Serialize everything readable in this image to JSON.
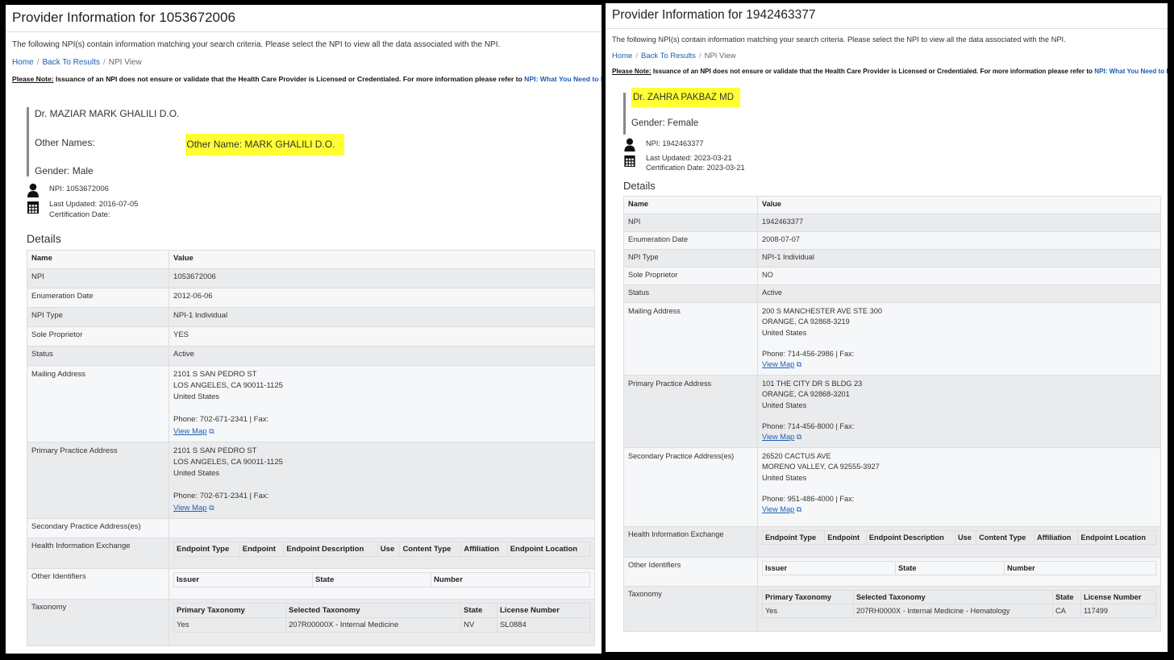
{
  "left": {
    "title": "Provider Information for 1053672006",
    "intro": "The following NPI(s) contain information matching your search criteria. Please select the NPI to view all the data associated with the NPI.",
    "breadcrumb": {
      "home": "Home",
      "back": "Back To Results",
      "current": "NPI View"
    },
    "note": {
      "label": "Please Note:",
      "text": " Issuance of an NPI does not ensure or validate that the Health Care Provider is Licensed or Credentialed. For more information please refer to ",
      "link": "NPI: What You Need to Know"
    },
    "provider_name": "Dr. MAZIAR MARK GHALILI D.O.",
    "other_names_label": "Other Names:",
    "other_name": "Other Name: MARK GHALILI D.O.",
    "gender": "Gender: Male",
    "npi_line": "NPI: 1053672006",
    "last_updated": "Last Updated: 2016-07-05",
    "certification": "Certification Date:",
    "details_heading": "Details",
    "col_name": "Name",
    "col_value": "Value",
    "rows": {
      "npi": {
        "name": "NPI",
        "value": "1053672006"
      },
      "enum": {
        "name": "Enumeration Date",
        "value": "2012-06-06"
      },
      "type": {
        "name": "NPI Type",
        "value": "NPI-1 Individual"
      },
      "sole": {
        "name": "Sole Proprietor",
        "value": "YES"
      },
      "status": {
        "name": "Status",
        "value": "Active"
      }
    },
    "mailing": {
      "name": "Mailing Address",
      "line1": "2101 S SAN PEDRO ST",
      "line2": "LOS ANGELES, CA 90011-1125",
      "line3": "United States",
      "phone": "Phone: 702-671-2341 | Fax:",
      "map": "View Map"
    },
    "primary": {
      "name": "Primary Practice Address",
      "line1": "2101 S SAN PEDRO ST",
      "line2": "LOS ANGELES, CA 90011-1125",
      "line3": "United States",
      "phone": "Phone: 702-671-2341 | Fax:",
      "map": "View Map"
    },
    "secondary_name": "Secondary Practice Address(es)",
    "hie_name": "Health Information Exchange",
    "hie_cols": [
      "Endpoint Type",
      "Endpoint",
      "Endpoint Description",
      "Use",
      "Content Type",
      "Affiliation",
      "Endpoint Location"
    ],
    "oid_name": "Other Identifiers",
    "oid_cols": [
      "Issuer",
      "State",
      "Number"
    ],
    "tax_name": "Taxonomy",
    "tax_cols": [
      "Primary Taxonomy",
      "Selected Taxonomy",
      "State",
      "License Number"
    ],
    "tax_row": [
      "Yes",
      "207R00000X - Internal Medicine",
      "NV",
      "SL0884"
    ]
  },
  "right": {
    "title": "Provider Information for 1942463377",
    "intro": "The following NPI(s) contain information matching your search criteria. Please select the NPI to view all the data associated with the NPI.",
    "breadcrumb": {
      "home": "Home",
      "back": "Back To Results",
      "current": "NPI View"
    },
    "note": {
      "label": "Please Note:",
      "text": " Issuance of an NPI does not ensure or validate that the Health Care Provider is Licensed or Credentialed. For more information please refer to ",
      "link": "NPI: What You Need to Know"
    },
    "provider_name": "Dr. ZAHRA PAKBAZ MD",
    "gender": "Gender: Female",
    "npi_line": "NPI: 1942463377",
    "last_updated": "Last Updated: 2023-03-21",
    "certification": "Certification Date: 2023-03-21",
    "details_heading": "Details",
    "col_name": "Name",
    "col_value": "Value",
    "rows": {
      "npi": {
        "name": "NPI",
        "value": "1942463377"
      },
      "enum": {
        "name": "Enumeration Date",
        "value": "2008-07-07"
      },
      "type": {
        "name": "NPI Type",
        "value": "NPI-1 Individual"
      },
      "sole": {
        "name": "Sole Proprietor",
        "value": "NO"
      },
      "status": {
        "name": "Status",
        "value": "Active"
      }
    },
    "mailing": {
      "name": "Mailing Address",
      "line1": "200 S MANCHESTER AVE STE 300",
      "line2": "ORANGE, CA 92868-3219",
      "line3": "United States",
      "phone": "Phone: 714-456-2986 | Fax:",
      "map": "View Map"
    },
    "primary": {
      "name": "Primary Practice Address",
      "line1": "101 THE CITY DR S BLDG 23",
      "line2": "ORANGE, CA 92868-3201",
      "line3": "United States",
      "phone": "Phone: 714-456-8000 | Fax:",
      "map": "View Map"
    },
    "secondary": {
      "name": "Secondary Practice Address(es)",
      "line1": "26520 CACTUS AVE",
      "line2": "MORENO VALLEY, CA 92555-3927",
      "line3": "United States",
      "phone": "Phone: 951-486-4000 | Fax:",
      "map": "View Map"
    },
    "hie_name": "Health Information Exchange",
    "hie_cols": [
      "Endpoint Type",
      "Endpoint",
      "Endpoint Description",
      "Use",
      "Content Type",
      "Affiliation",
      "Endpoint Location"
    ],
    "oid_name": "Other Identifiers",
    "oid_cols": [
      "Issuer",
      "State",
      "Number"
    ],
    "tax_name": "Taxonomy",
    "tax_cols": [
      "Primary Taxonomy",
      "Selected Taxonomy",
      "State",
      "License Number"
    ],
    "tax_row": [
      "Yes",
      "207RH0000X - Internal Medicine - Hematology",
      "CA",
      "117499"
    ]
  },
  "icons": {
    "person": "person-icon",
    "calendar": "calendar-icon",
    "external": "external-link-icon"
  },
  "colors": {
    "highlight": "#ffff33",
    "link": "#1a5fb4",
    "row_alt": "#eaebed"
  }
}
